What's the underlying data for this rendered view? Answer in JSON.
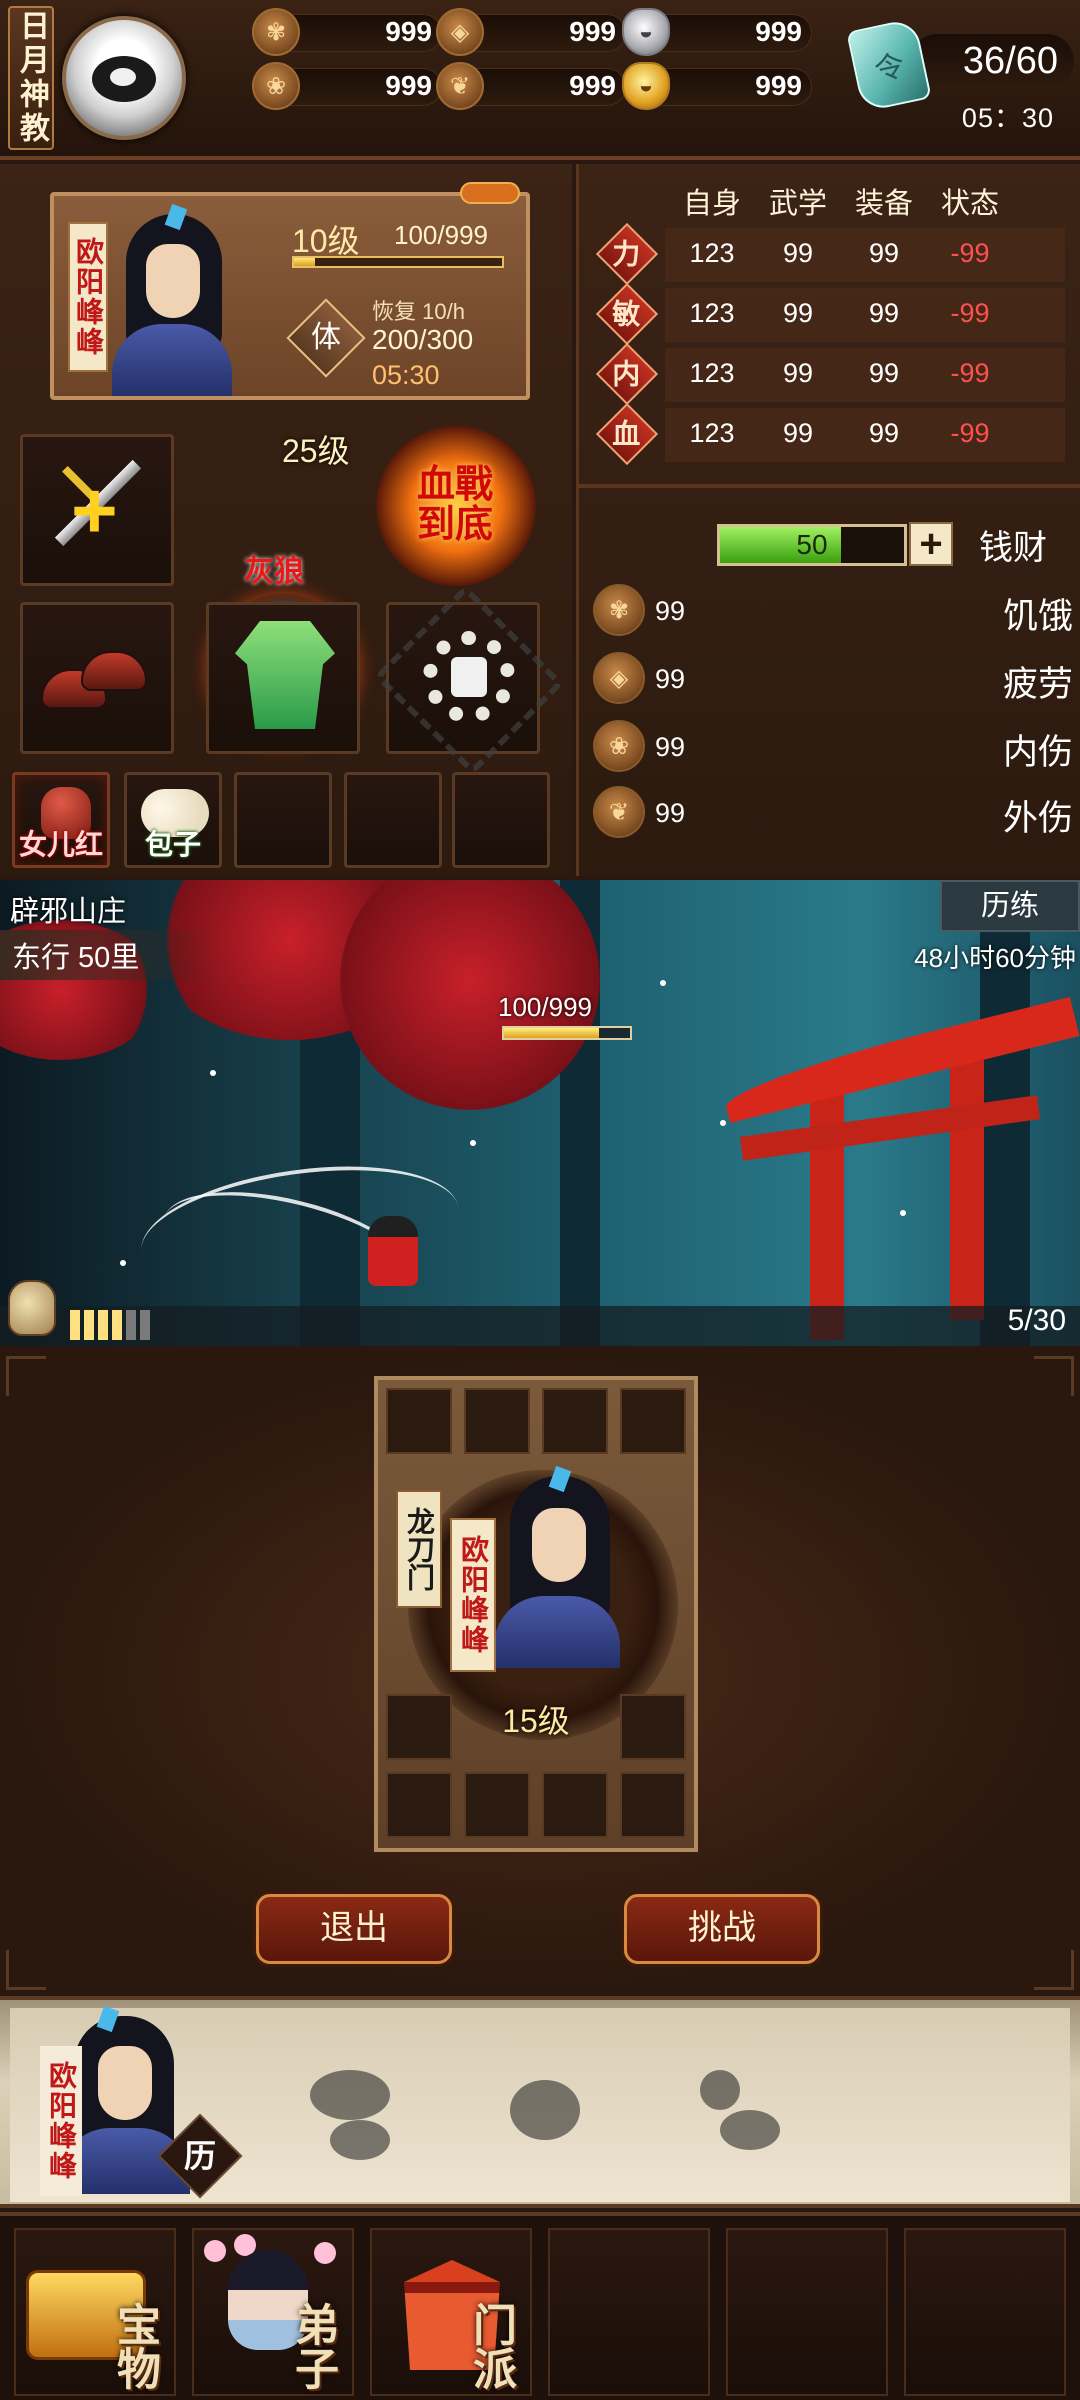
{
  "sect": {
    "name": "日月神教"
  },
  "resources": [
    {
      "icon": "grain-icon",
      "value": "999"
    },
    {
      "icon": "fatigue-coin-icon",
      "value": "999"
    },
    {
      "icon": "silver-ingot-icon",
      "value": "999"
    },
    {
      "icon": "herb-icon",
      "value": "999"
    },
    {
      "icon": "leaf-coin-icon",
      "value": "999"
    },
    {
      "icon": "gold-ingot-icon",
      "value": "999"
    }
  ],
  "energy": {
    "count": "36/60",
    "timer": "05：30"
  },
  "character": {
    "name": "欧阳峰峰",
    "level": "10级",
    "xp": "100/999",
    "xp_fraction": 0.1,
    "stamina_label": "体",
    "recover": "恢复 10/h",
    "stamina": "200/300",
    "stamina_timer": "05:30"
  },
  "equipment": {
    "pet_level": "25级",
    "pet_name": "灰狼",
    "skill_name": "血戰到底",
    "items": [
      "女儿红",
      "包子",
      "",
      "",
      ""
    ]
  },
  "stats": {
    "headers": [
      "自身",
      "武学",
      "装备",
      "状态"
    ],
    "rows": [
      {
        "label": "力",
        "values": [
          "123",
          "99",
          "99",
          "-99"
        ]
      },
      {
        "label": "敏",
        "values": [
          "123",
          "99",
          "99",
          "-99"
        ]
      },
      {
        "label": "内",
        "values": [
          "123",
          "99",
          "99",
          "-99"
        ]
      },
      {
        "label": "血",
        "values": [
          "123",
          "99",
          "99",
          "-99"
        ]
      }
    ],
    "negative_color": "#ff5050"
  },
  "money": {
    "value": "50",
    "fraction": 0.66,
    "label": "钱财",
    "plus": "+"
  },
  "conditions": [
    {
      "icon": "grain-icon",
      "value": "99",
      "label": "饥饿"
    },
    {
      "icon": "fatigue-coin-icon",
      "value": "99",
      "label": "疲劳"
    },
    {
      "icon": "herb-icon",
      "value": "99",
      "label": "内伤"
    },
    {
      "icon": "leaf-coin-icon",
      "value": "99",
      "label": "外伤"
    }
  ],
  "scene": {
    "location": "辟邪山庄",
    "travel": "东行  50里",
    "trial_button": "历练",
    "timer": "48小时60分钟",
    "enemy_hp": "100/999",
    "enemy_hp_fraction": 0.75,
    "progress_filled": 4,
    "progress_total": 6,
    "wave": "5/30"
  },
  "formation": {
    "sect_name": "龙刀门",
    "hero_name": "欧阳峰峰",
    "level": "15级",
    "exit_label": "退出",
    "challenge_label": "挑战"
  },
  "trial": {
    "hero_name": "欧阳峰峰",
    "badge": "历"
  },
  "nav": [
    {
      "label": "宝物"
    },
    {
      "label": "弟子"
    },
    {
      "label": "门派"
    },
    {
      "label": ""
    },
    {
      "label": ""
    },
    {
      "label": ""
    }
  ],
  "colors": {
    "accent": "#c09060",
    "background": "#2a1810",
    "brand_red": "#c01818"
  }
}
